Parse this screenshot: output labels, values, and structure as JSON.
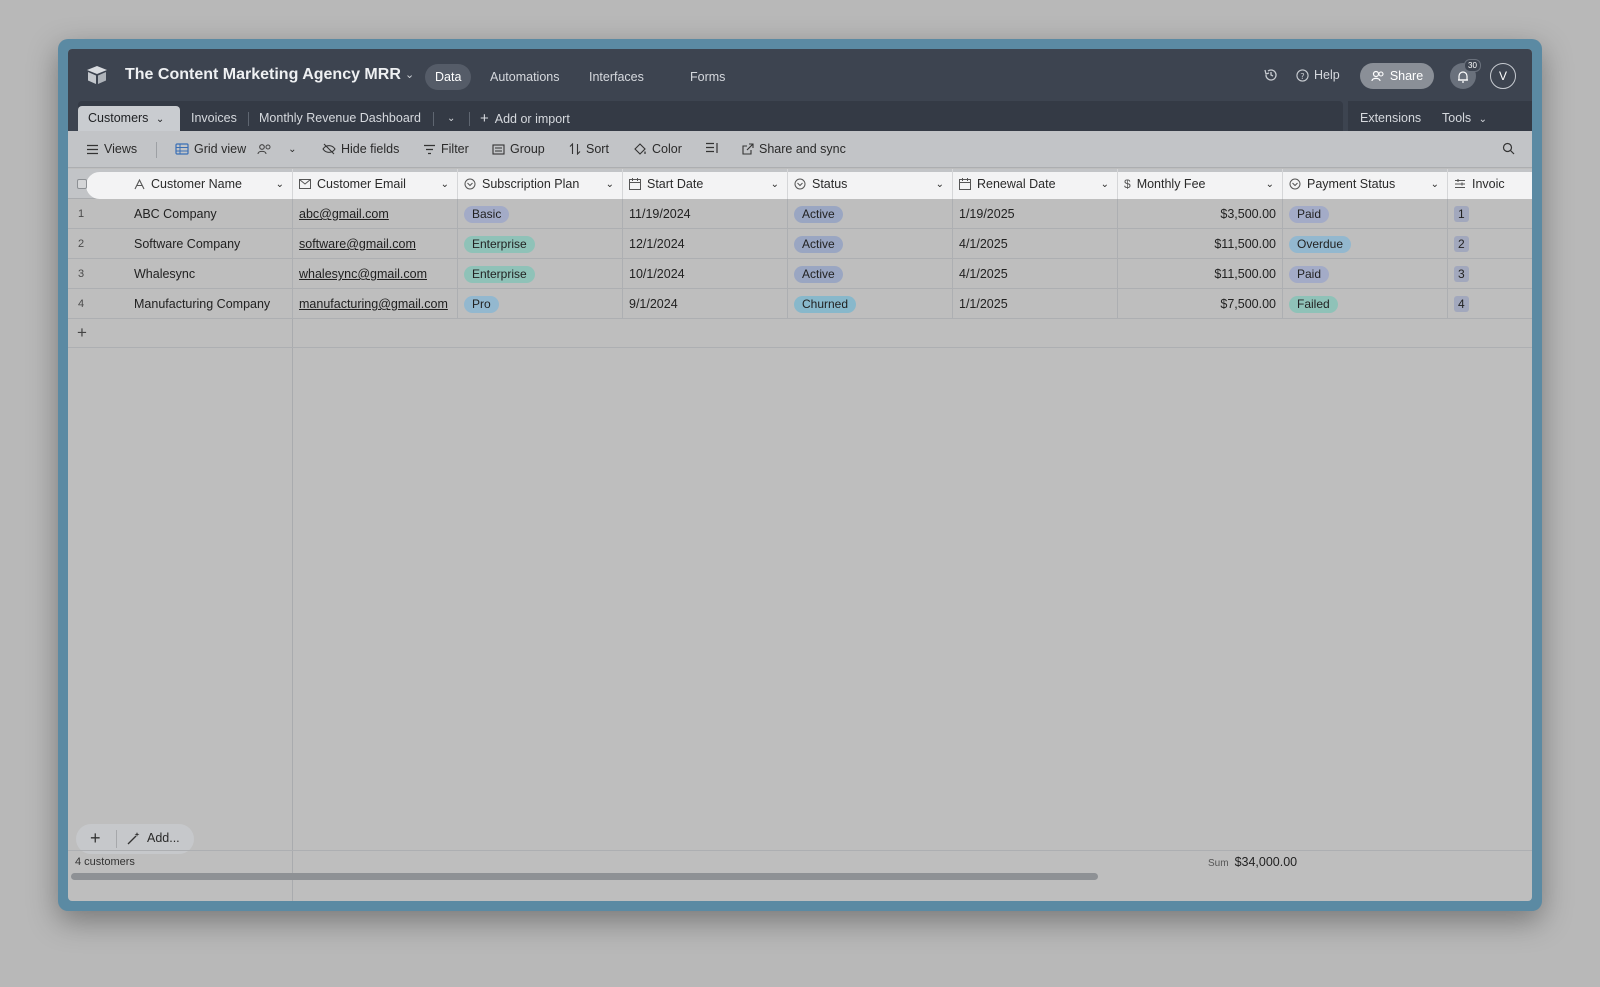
{
  "app": {
    "base_title": "The Content Marketing Agency MRR",
    "nav": [
      "Data",
      "Automations",
      "Interfaces",
      "Forms"
    ],
    "help_label": "Help",
    "share_label": "Share",
    "notification_count": "30",
    "avatar_initial": "V"
  },
  "tables": {
    "tabs": [
      "Customers",
      "Invoices",
      "Monthly Revenue Dashboard"
    ],
    "add_label": "Add or import",
    "extensions_label": "Extensions",
    "tools_label": "Tools"
  },
  "toolbar": {
    "views": "Views",
    "grid_view": "Grid view",
    "hide_fields": "Hide fields",
    "filter": "Filter",
    "group": "Group",
    "sort": "Sort",
    "color": "Color",
    "share_sync": "Share and sync"
  },
  "columns": [
    "Customer Name",
    "Customer Email",
    "Subscription Plan",
    "Start Date",
    "Status",
    "Renewal Date",
    "Monthly Fee",
    "Payment Status",
    "Invoic"
  ],
  "rows": [
    {
      "num": "1",
      "name": "ABC Company",
      "email": "abc@gmail.com",
      "plan": "Basic",
      "start": "11/19/2024",
      "status": "Active",
      "renewal": "1/19/2025",
      "fee": "$3,500.00",
      "payment": "Paid",
      "invoice": "1"
    },
    {
      "num": "2",
      "name": "Software Company",
      "email": "software@gmail.com",
      "plan": "Enterprise",
      "start": "12/1/2024",
      "status": "Active",
      "renewal": "4/1/2025",
      "fee": "$11,500.00",
      "payment": "Overdue",
      "invoice": "2"
    },
    {
      "num": "3",
      "name": "Whalesync",
      "email": "whalesync@gmail.com",
      "plan": "Enterprise",
      "start": "10/1/2024",
      "status": "Active",
      "renewal": "4/1/2025",
      "fee": "$11,500.00",
      "payment": "Paid",
      "invoice": "3"
    },
    {
      "num": "4",
      "name": "Manufacturing Company",
      "email": "manufacturing@gmail.com",
      "plan": "Pro",
      "start": "9/1/2024",
      "status": "Churned",
      "renewal": "1/1/2025",
      "fee": "$7,500.00",
      "payment": "Failed",
      "invoice": "4"
    }
  ],
  "colors": {
    "plan": {
      "Basic": "#a3abc7",
      "Enterprise": "#8fc2b8",
      "Pro": "#93b8cf"
    },
    "status": {
      "Active": "#9aa6c2",
      "Churned": "#88b8cb"
    },
    "payment": {
      "Paid": "#a3abc7",
      "Overdue": "#93b8cf",
      "Failed": "#8fc2b8"
    }
  },
  "footer": {
    "add_label": "Add...",
    "record_count": "4 customers",
    "sum_label": "Sum",
    "sum_value": "$34,000.00"
  }
}
